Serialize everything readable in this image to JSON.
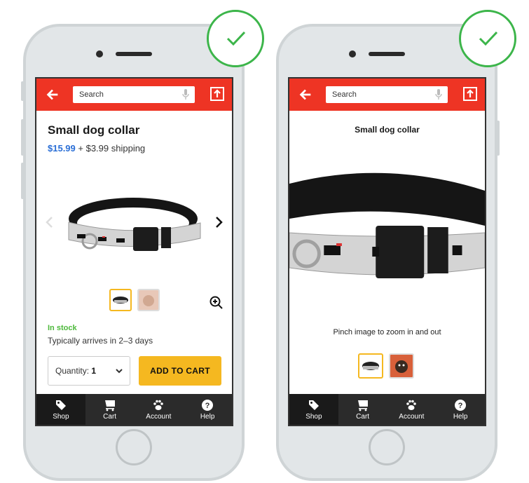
{
  "colors": {
    "header": "#ee3424",
    "price": "#2b6fd6",
    "in_stock": "#4cb83a",
    "cta": "#f5b820",
    "nav": "#2b2b2b",
    "check": "#3cb54a"
  },
  "screens": [
    {
      "header": {
        "back_icon": "arrow-left-icon",
        "search_placeholder": "Search",
        "mic_icon": "microphone-icon",
        "share_icon": "share-icon"
      },
      "product": {
        "title": "Small dog collar",
        "price": "$15.99",
        "shipping": "+ $3.99 shipping",
        "image": "dog-collar-photo",
        "prev_icon": "chevron-left-icon",
        "next_icon": "chevron-right-icon",
        "thumbnails": [
          {
            "image": "collar-thumbnail",
            "selected": true
          },
          {
            "image": "dog-thumbnail",
            "selected": false
          }
        ],
        "zoom_icon": "zoom-in-icon",
        "stock_status": "In stock",
        "delivery": "Typically arrives in 2–3 days",
        "quantity_label": "Quantity:",
        "quantity_value": "1",
        "add_to_cart": "ADD TO CART"
      },
      "nav": [
        {
          "label": "Shop",
          "icon": "tag-icon",
          "active": true
        },
        {
          "label": "Cart",
          "icon": "cart-icon",
          "active": false
        },
        {
          "label": "Account",
          "icon": "paw-icon",
          "active": false
        },
        {
          "label": "Help",
          "icon": "help-icon",
          "active": false
        }
      ],
      "badge": "check-icon"
    },
    {
      "header": {
        "back_icon": "arrow-left-icon",
        "search_placeholder": "Search",
        "mic_icon": "microphone-icon",
        "share_icon": "share-icon"
      },
      "product": {
        "title": "Small dog collar",
        "image": "dog-collar-photo-zoomed",
        "hint": "Pinch image to zoom in and out",
        "thumbnails": [
          {
            "image": "collar-thumbnail",
            "selected": true
          },
          {
            "image": "dog-thumbnail",
            "selected": false
          }
        ]
      },
      "nav": [
        {
          "label": "Shop",
          "icon": "tag-icon",
          "active": true
        },
        {
          "label": "Cart",
          "icon": "cart-icon",
          "active": false
        },
        {
          "label": "Account",
          "icon": "paw-icon",
          "active": false
        },
        {
          "label": "Help",
          "icon": "help-icon",
          "active": false
        }
      ],
      "badge": "check-icon"
    }
  ]
}
